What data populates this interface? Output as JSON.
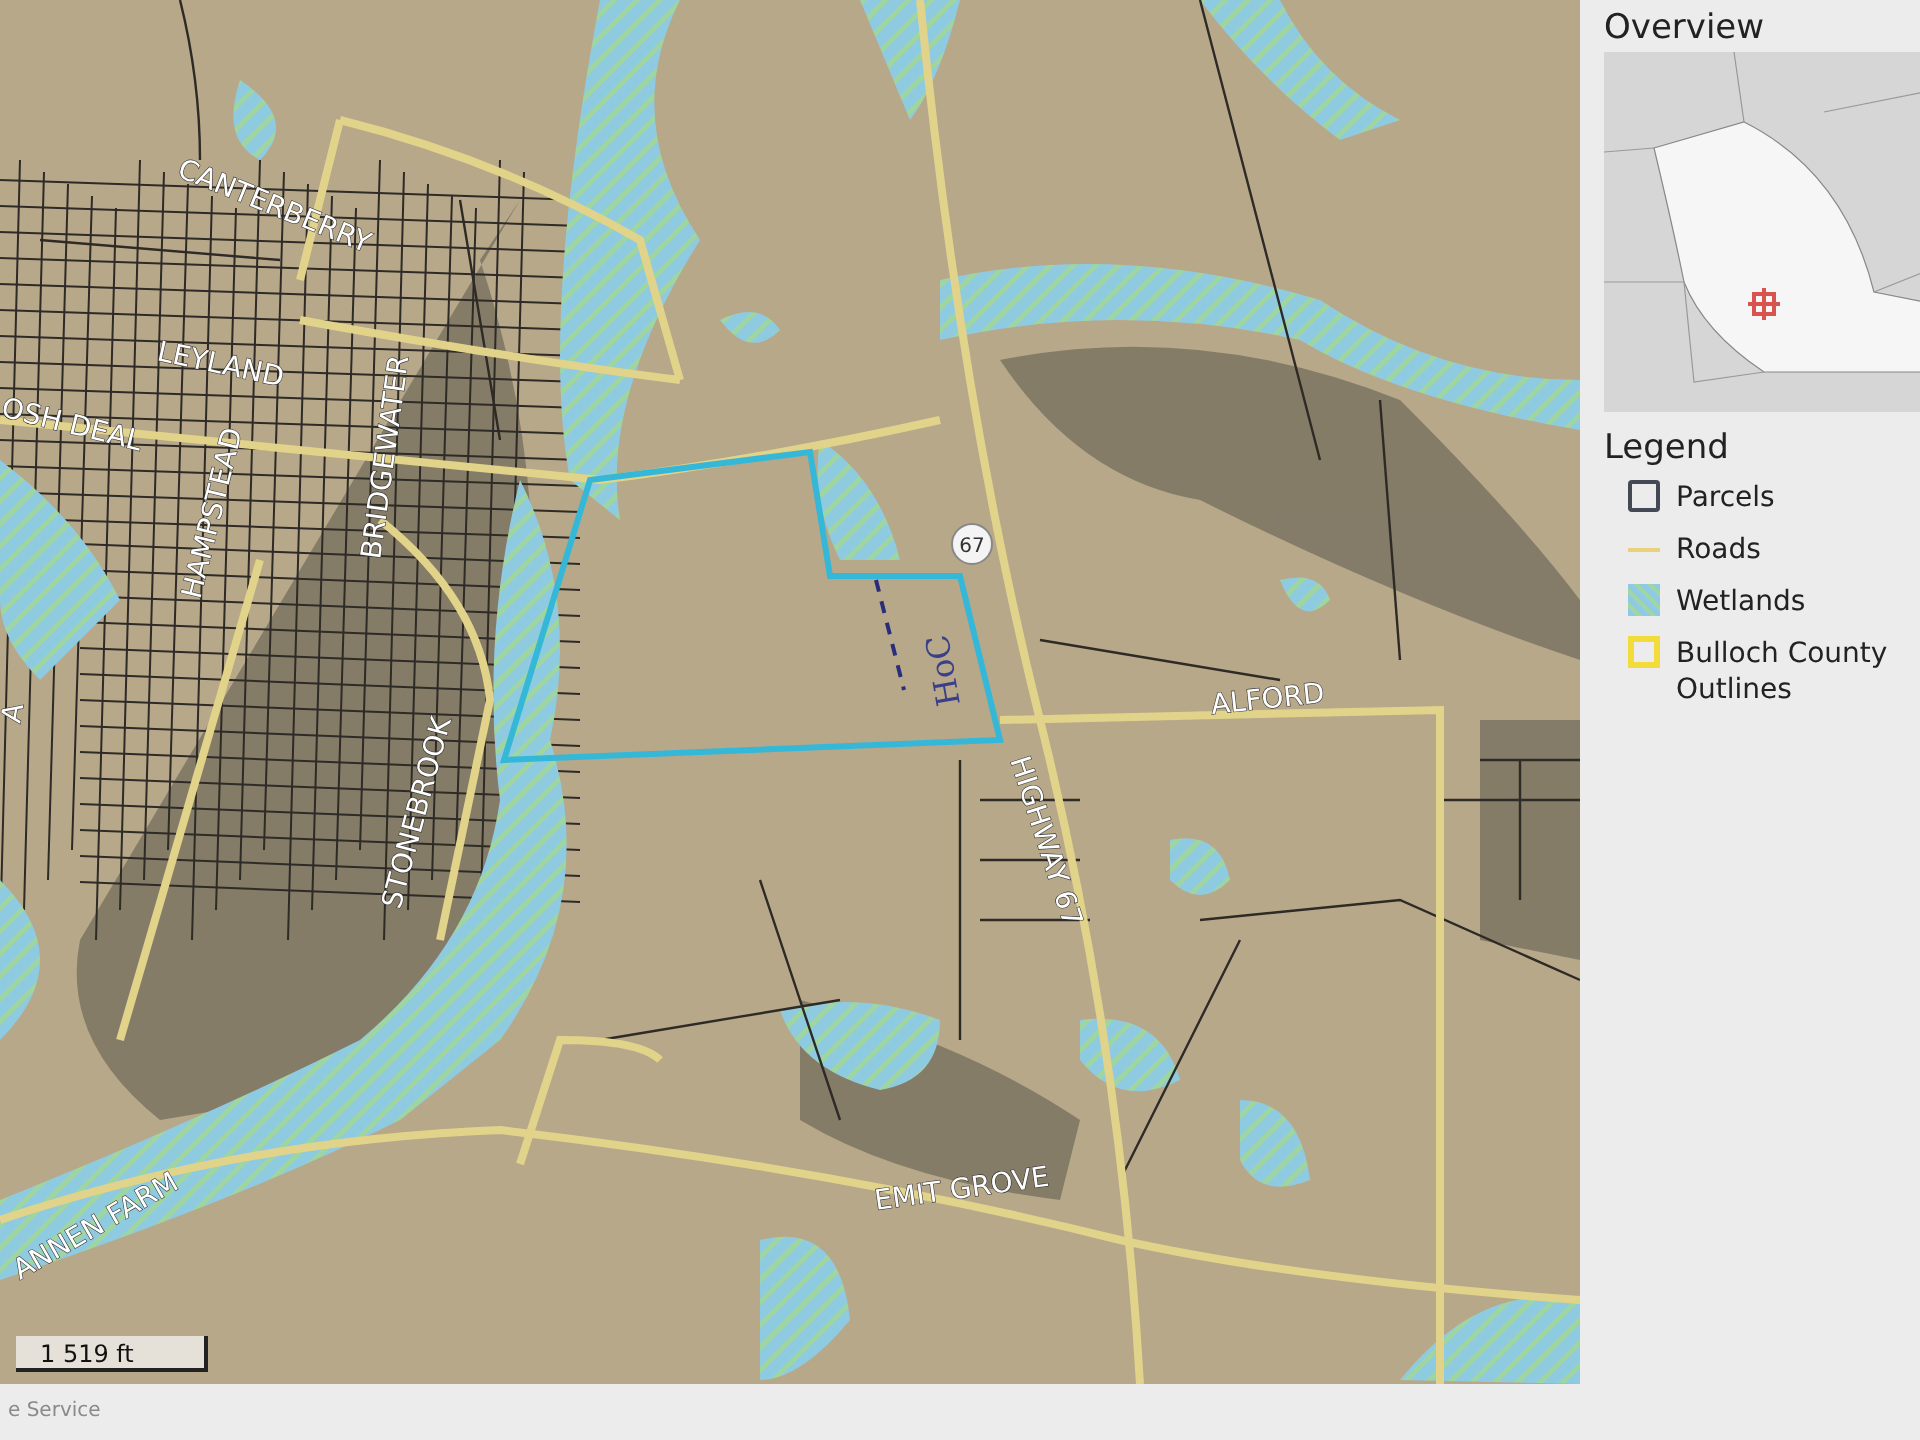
{
  "map": {
    "road_labels": [
      {
        "text": "CANTERBERRY"
      },
      {
        "text": "LEYLAND"
      },
      {
        "text": "OSH DEAL"
      },
      {
        "text": "HAMPSTEAD"
      },
      {
        "text": "BRIDGEWATER"
      },
      {
        "text": "STONEBROOK"
      },
      {
        "text": "A"
      },
      {
        "text": "ANNEN FARM"
      },
      {
        "text": "EMIT GROVE"
      },
      {
        "text": "HIGHWAY 67"
      },
      {
        "text": "ALFORD"
      }
    ],
    "route_shield": "67",
    "annotation": "HoC",
    "scale": "1 519 ft"
  },
  "sidebar": {
    "overview_title": "Overview",
    "legend_title": "Legend",
    "legend": [
      {
        "kind": "parcels",
        "label": "Parcels"
      },
      {
        "kind": "roads",
        "label": "Roads"
      },
      {
        "kind": "wetlands",
        "label": "Wetlands"
      },
      {
        "kind": "outline",
        "label": "Bulloch County Outlines"
      }
    ]
  },
  "footer": "e Service"
}
